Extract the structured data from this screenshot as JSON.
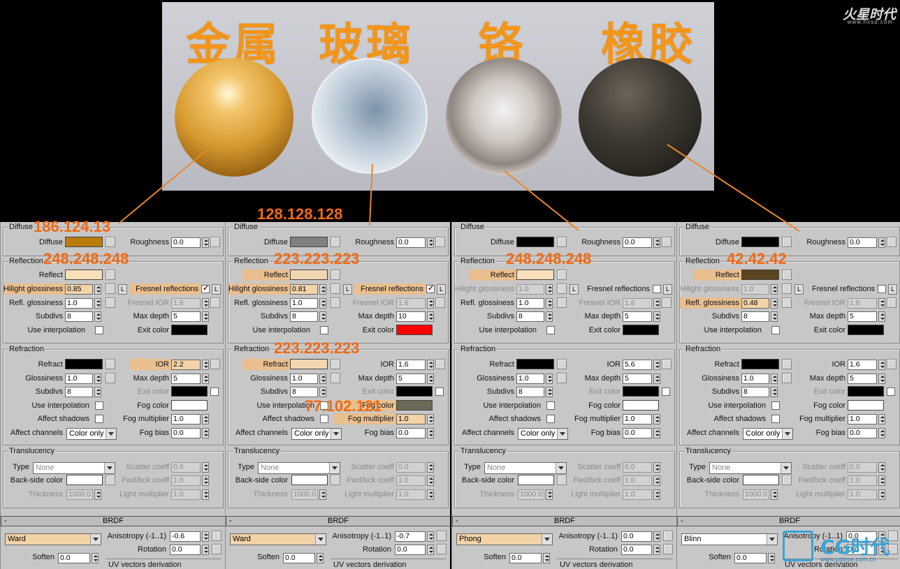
{
  "top": {
    "titles": [
      "金属",
      "玻璃",
      "铬",
      "橡胶"
    ],
    "logo": "火星时代",
    "logo_url": "www.hxsd.com"
  },
  "annotations": [
    "186.124.13",
    "248.248.248",
    "128.128.128",
    "223.223.223",
    "223.223.223",
    "77.102.121",
    "248.248.248",
    "42.42.42"
  ],
  "labels": {
    "diffuse_group": "Diffuse",
    "diffuse": "Diffuse",
    "roughness": "Roughness",
    "reflection_group": "Reflection",
    "reflect": "Reflect",
    "hilight_gloss": "Hilight glossiness",
    "fresnel": "Fresnel reflections",
    "refl_gloss": "Refl. glossiness",
    "fresnel_ior": "Fresnel IOR",
    "subdivs": "Subdivs",
    "max_depth": "Max depth",
    "use_interp": "Use interpolation",
    "exit_color": "Exit color",
    "refraction_group": "Refraction",
    "refract": "Refract",
    "ior": "IOR",
    "glossiness": "Glossiness",
    "fog_color": "Fog color",
    "affect_shadows": "Affect shadows",
    "fog_mult": "Fog multiplier",
    "affect_channels": "Affect channels",
    "fog_bias": "Fog bias",
    "color_only": "Color only",
    "l": "L",
    "translucency_group": "Translucency",
    "type": "Type",
    "none": "None",
    "scatter": "Scatter coeff",
    "backside": "Back-side color",
    "fwdbck": "Fwd/bck coeff",
    "thickness": "Thickness",
    "light_mult": "Light multiplier",
    "brdf": "BRDF",
    "minus": "-",
    "anisotropy": "Anisotropy (-1..1)",
    "rotation": "Rotation",
    "soften": "Soften",
    "uv_deriv": "UV vectors derivation"
  },
  "panels": [
    {
      "diffuse_color": "#b87c0d",
      "roughness": "0.0",
      "reflect_color": "#f8e0b8",
      "hilight": "0.85",
      "refl_gloss": "1.0",
      "fresnel_ior": "1.6",
      "subdivs": "8",
      "max_depth": "5",
      "exit_color": "#000000",
      "fresnel_on": true,
      "hilight_hl": true,
      "refract_color": "#000000",
      "ior": "2.2",
      "glossiness": "1.0",
      "r_subdivs": "8",
      "r_max_depth": "5",
      "fog_color": "#ffffff",
      "fog_mult": "1.0",
      "fog_bias": "0.0",
      "ior_hl": true,
      "t_thickness": "1000.0",
      "t_scatter": "0.0",
      "t_fwd": "1.0",
      "t_light": "1.0",
      "brdf_type": "Ward",
      "anisotropy": "-0.6",
      "rotation": "0.0",
      "soften": "0.0"
    },
    {
      "diffuse_color": "#808080",
      "roughness": "0.0",
      "reflect_color": "#f2d6b0",
      "hilight": "0.81",
      "refl_gloss": "1.0",
      "fresnel_ior": "1.6",
      "subdivs": "8",
      "max_depth": "10",
      "exit_color": "#ff0000",
      "fresnel_on": true,
      "hilight_hl": true,
      "refract_color": "#f2d6b0",
      "ior": "1.6",
      "glossiness": "1.0",
      "r_subdivs": "8",
      "r_max_depth": "5",
      "fog_color": "#6b6a55",
      "fog_mult": "1.0",
      "fog_bias": "0.0",
      "ior_hl": false,
      "t_thickness": "1000.0",
      "t_scatter": "0.0",
      "t_fwd": "1.0",
      "t_light": "1.0",
      "brdf_type": "Ward",
      "anisotropy": "-0.7",
      "rotation": "0.0",
      "soften": "0.0"
    },
    {
      "diffuse_color": "#000000",
      "roughness": "0.0",
      "reflect_color": "#f8e0b8",
      "hilight": "1.0",
      "refl_gloss": "1.0",
      "fresnel_ior": "1.6",
      "subdivs": "8",
      "max_depth": "5",
      "exit_color": "#000000",
      "fresnel_on": false,
      "hilight_hl": false,
      "refract_color": "#000000",
      "ior": "5.6",
      "glossiness": "1.0",
      "r_subdivs": "8",
      "r_max_depth": "5",
      "fog_color": "#ffffff",
      "fog_mult": "1.0",
      "fog_bias": "0.0",
      "ior_hl": false,
      "t_thickness": "1000.0",
      "t_scatter": "0.0",
      "t_fwd": "1.0",
      "t_light": "1.0",
      "brdf_type": "Phong",
      "anisotropy": "0.0",
      "rotation": "0.0",
      "soften": "0.0"
    },
    {
      "diffuse_color": "#000000",
      "roughness": "0.0",
      "reflect_color": "#5a4420",
      "hilight": "1.0",
      "refl_gloss": "0.48",
      "fresnel_ior": "1.6",
      "subdivs": "8",
      "max_depth": "5",
      "exit_color": "#000000",
      "fresnel_on": false,
      "hilight_hl": false,
      "refract_color": "#000000",
      "ior": "1.6",
      "glossiness": "1.0",
      "r_subdivs": "8",
      "r_max_depth": "5",
      "fog_color": "#ffffff",
      "fog_mult": "1.0",
      "fog_bias": "0.0",
      "ior_hl": false,
      "t_thickness": "1000.0",
      "t_scatter": "0.0",
      "t_fwd": "1.0",
      "t_light": "1.0",
      "brdf_type": "Blinn",
      "anisotropy": "0.0",
      "rotation": "0.0",
      "soften": "0.0"
    }
  ],
  "watermark": {
    "brand": "CG时代",
    "url": "www.cgtime.com.cn"
  }
}
